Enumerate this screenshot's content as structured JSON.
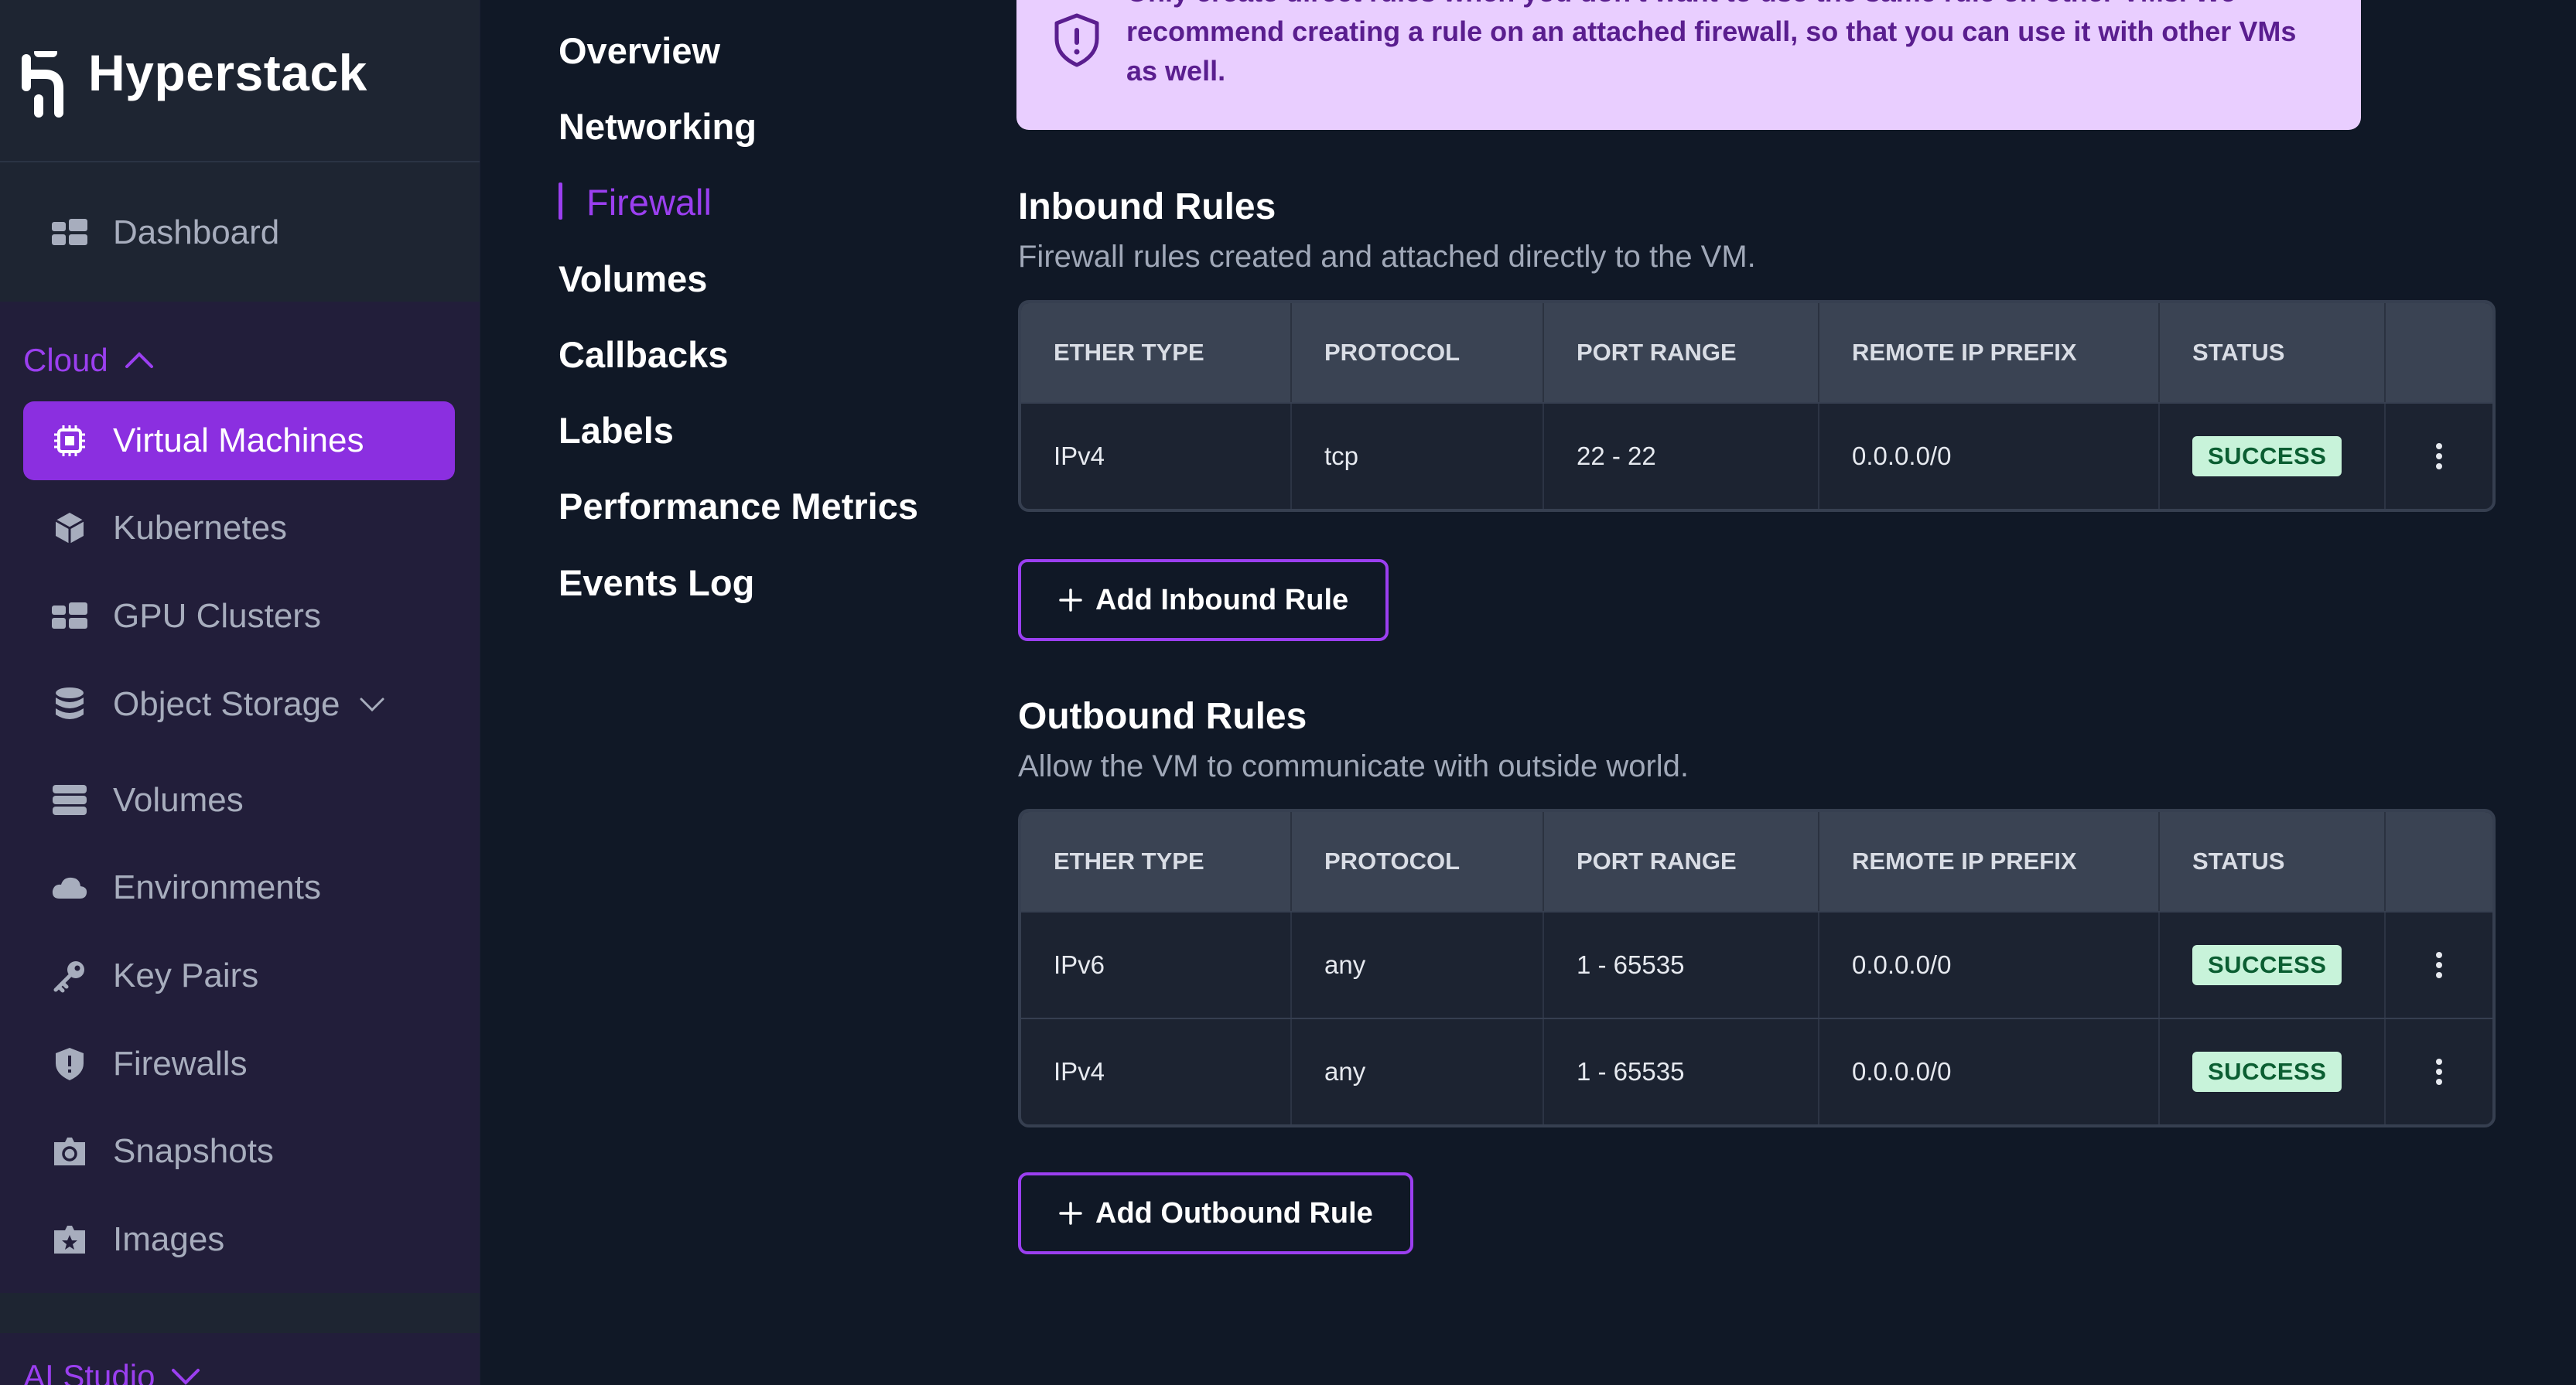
{
  "brand": {
    "name": "Hyperstack"
  },
  "sidebar": {
    "dashboard": "Dashboard",
    "cloud_section": "Cloud",
    "items": [
      {
        "label": "Virtual Machines",
        "icon": "chip-icon"
      },
      {
        "label": "Kubernetes",
        "icon": "cube-icon"
      },
      {
        "label": "GPU Clusters",
        "icon": "cluster-icon"
      },
      {
        "label": "Object Storage",
        "icon": "database-icon"
      },
      {
        "label": "Volumes",
        "icon": "storage-icon"
      },
      {
        "label": "Environments",
        "icon": "cloud-icon"
      },
      {
        "label": "Key Pairs",
        "icon": "key-icon"
      },
      {
        "label": "Firewalls",
        "icon": "shield-icon"
      },
      {
        "label": "Snapshots",
        "icon": "camera-icon"
      },
      {
        "label": "Images",
        "icon": "image-icon"
      }
    ],
    "ai_section": "AI Studio"
  },
  "subnav": {
    "items": [
      "Overview",
      "Networking",
      "Firewall",
      "Volumes",
      "Callbacks",
      "Labels",
      "Performance Metrics",
      "Events Log"
    ],
    "active": "Firewall"
  },
  "notice": {
    "text": "Only create direct rules when you don't want to use the same rule on other VMs. We recommend creating a rule on an attached firewall, so that you can use it with other VMs as well."
  },
  "inbound": {
    "title": "Inbound Rules",
    "subtitle": "Firewall rules created and attached directly to the VM.",
    "columns": [
      "ETHER TYPE",
      "PROTOCOL",
      "PORT RANGE",
      "REMOTE IP PREFIX",
      "STATUS"
    ],
    "rows": [
      {
        "ether_type": "IPv4",
        "protocol": "tcp",
        "port_range": "22 - 22",
        "remote_ip": "0.0.0.0/0",
        "status": "SUCCESS"
      }
    ],
    "add_button": "Add Inbound Rule"
  },
  "outbound": {
    "title": "Outbound Rules",
    "subtitle": "Allow the VM to communicate with outside world.",
    "columns": [
      "ETHER TYPE",
      "PROTOCOL",
      "PORT RANGE",
      "REMOTE IP PREFIX",
      "STATUS"
    ],
    "rows": [
      {
        "ether_type": "IPv6",
        "protocol": "any",
        "port_range": "1 - 65535",
        "remote_ip": "0.0.0.0/0",
        "status": "SUCCESS"
      },
      {
        "ether_type": "IPv4",
        "protocol": "any",
        "port_range": "1 - 65535",
        "remote_ip": "0.0.0.0/0",
        "status": "SUCCESS"
      }
    ],
    "add_button": "Add Outbound Rule"
  },
  "colors": {
    "accent": "#9b3ff0",
    "active_nav": "#8b2fe0",
    "success_bg": "#c8f3da",
    "success_text": "#0b5e32",
    "notice_bg": "#e9ceff"
  }
}
